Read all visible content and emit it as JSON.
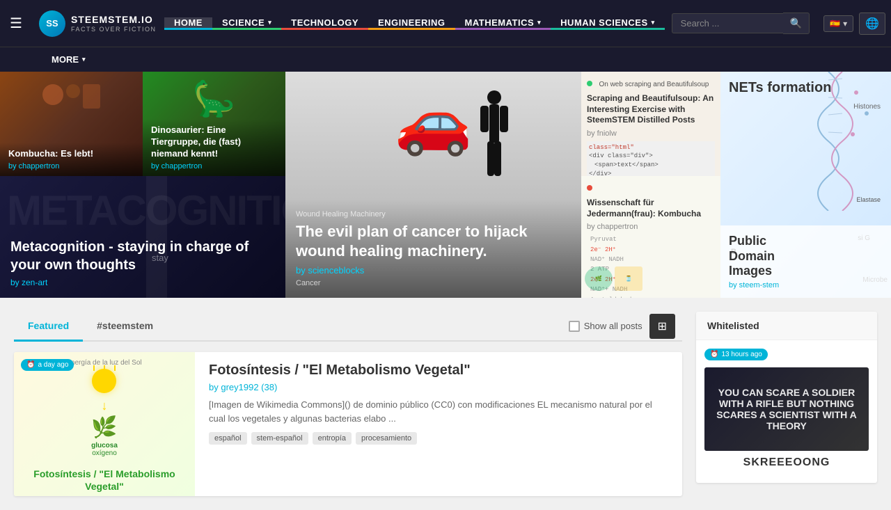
{
  "brand": {
    "logo_text": "SS",
    "title": "STEEMSTEM.IO",
    "subtitle": "FACTS OVER FICTION"
  },
  "navbar": {
    "items": [
      {
        "id": "home",
        "label": "HOME",
        "active": true
      },
      {
        "id": "science",
        "label": "SCIENCE",
        "has_arrow": true,
        "color": "science"
      },
      {
        "id": "technology",
        "label": "TECHNOLOGY",
        "has_arrow": false
      },
      {
        "id": "engineering",
        "label": "ENGINEERING",
        "has_arrow": false
      },
      {
        "id": "mathematics",
        "label": "MATHEMATICS",
        "has_arrow": true
      },
      {
        "id": "human-sciences",
        "label": "HUMAN SCIENCES",
        "has_arrow": true
      }
    ],
    "more_label": "MORE",
    "search_placeholder": "Search ..."
  },
  "hero": {
    "cells": [
      {
        "id": "kombucha",
        "title": "Kombucha: Es lebt!",
        "author": "by chappertron",
        "bg": "kombucha"
      },
      {
        "id": "dino",
        "title": "Dinosaurier: Eine Tiergruppe, die (fast) niemand kennt!",
        "author": "by chappertron",
        "bg": "dino"
      },
      {
        "id": "cancer",
        "title": "The evil plan of cancer to hijack wound healing machinery.",
        "author": "by scienceblocks",
        "label1": "Wound Healing Machinery",
        "label2": "Cancer"
      },
      {
        "id": "scraping",
        "title": "Scraping and Beautifulsoup: An Interesting Exercise with SteemSTEM Distilled Posts",
        "author": "by fniolw",
        "sub_title": "On web scraping and Beautifulsoup"
      },
      {
        "id": "nets",
        "title": "NETs formation",
        "author": "by steem-stem",
        "sub": "Public Domain Images"
      },
      {
        "id": "metacog",
        "title": "Metacognition - staying in charge of your own thoughts",
        "author": "by zen-art",
        "bg_text": "METACOGNITION"
      },
      {
        "id": "wissenschaft",
        "title": "Wissenschaft für Jedermann(frau): Kombucha",
        "author": "by chappertron"
      }
    ]
  },
  "tabs": {
    "items": [
      {
        "id": "featured",
        "label": "Featured",
        "active": true
      },
      {
        "id": "steemstem",
        "label": "#steemstem",
        "active": false
      }
    ],
    "show_all_label": "Show all posts",
    "grid_icon": "⊞"
  },
  "post": {
    "time_badge": "a day ago",
    "title": "Fotosíntesis / \"El Metabolismo Vegetal\"",
    "author": "by grey1992 (38)",
    "excerpt": "[Imagen de Wikimedia Commons]() de dominio público (CC0) con modificaciones EL mecanismo natural por el cual los vegetales y algunas bacterias elabo ...",
    "tags": [
      "español",
      "stem-español",
      "entropía",
      "procesamiento"
    ],
    "thumb_text": "Fotosíntesis / \"El Metabolismo Vegetal\"",
    "thumb_sub": "energía de la luz del Sol",
    "thumb_labels": [
      "glucosa",
      "oxígeno"
    ]
  },
  "right_panel": {
    "header": "Whitelisted",
    "time_badge": "13 hours ago",
    "image_text": "YOU CAN SCARE A SOLDIER WITH A RIFLE\nBUT NOTHING SCARES A SCIENTIST WITH A THEORY",
    "sub_title": "SKREEEOONG"
  }
}
